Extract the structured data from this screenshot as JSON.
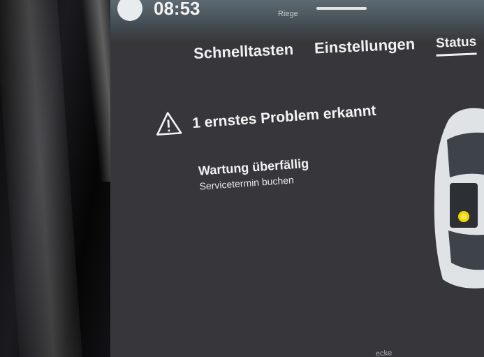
{
  "status_bar": {
    "time": "08:53",
    "map_label": "Riege"
  },
  "tabs": [
    {
      "label": "Schnelltasten",
      "active": false
    },
    {
      "label": "Einstellungen",
      "active": false
    },
    {
      "label": "Status",
      "active": true
    }
  ],
  "alert": {
    "icon": "warning-triangle-icon",
    "title": "1 ernstes Problem erkannt"
  },
  "service": {
    "title": "Wartung überfällig",
    "link": "Servicetermin buchen"
  },
  "bottom_text": "ecke",
  "colors": {
    "screen_bg": "#37373b",
    "text": "#f3f3f3",
    "car_body": "#dfe3e6",
    "warning_dot": "#f3d400"
  }
}
